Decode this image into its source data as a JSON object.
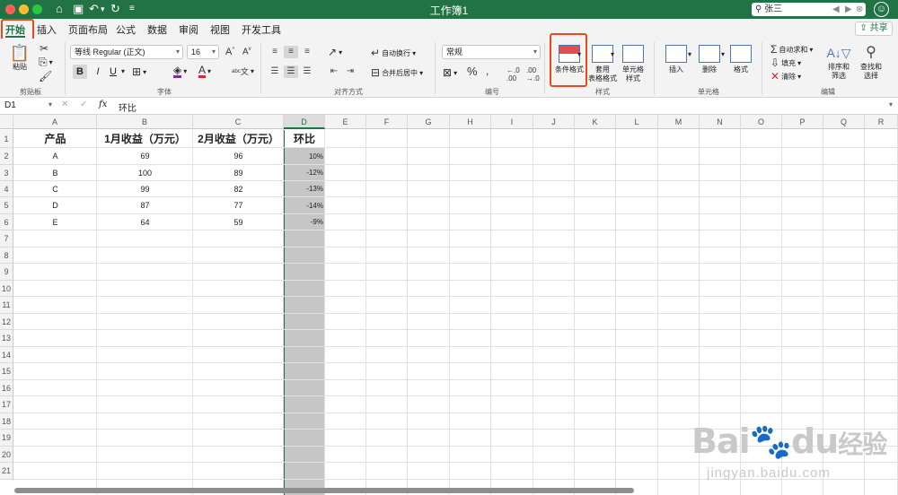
{
  "app": {
    "title": "工作簿1",
    "search_value": "张三",
    "share_label": "共享"
  },
  "menu": {
    "tabs": [
      "开始",
      "插入",
      "页面布局",
      "公式",
      "数据",
      "审阅",
      "视图",
      "开发工具"
    ]
  },
  "ribbon": {
    "clipboard": {
      "paste": "粘贴",
      "label": "剪贴板"
    },
    "font": {
      "name": "等线 Regular (正文)",
      "size": "16",
      "bold": "B",
      "italic": "I",
      "underline": "U",
      "label": "字体"
    },
    "alignment": {
      "wrap": "自动换行",
      "merge": "合并后居中",
      "label": "对齐方式"
    },
    "number": {
      "format": "常规",
      "percent": "%",
      "label": "编号"
    },
    "styles": {
      "conditional": "条件格式",
      "table_line1": "套用",
      "table_line2": "表格格式",
      "cell_line1": "单元格",
      "cell_line2": "样式",
      "label": "样式"
    },
    "cells": {
      "insert": "插入",
      "delete": "删除",
      "format": "格式",
      "label": "单元格"
    },
    "editing": {
      "autosum": "自动求和",
      "fill": "填充",
      "clear": "清除",
      "sort_line1": "排序和",
      "sort_line2": "筛选",
      "find_line1": "查找和",
      "find_line2": "选择",
      "label": "编辑"
    }
  },
  "formula_bar": {
    "cell_ref": "D1",
    "fx": "fx",
    "content": "环比"
  },
  "columns": [
    "A",
    "B",
    "C",
    "D",
    "E",
    "F",
    "G",
    "H",
    "I",
    "J",
    "K",
    "L",
    "M",
    "N",
    "O",
    "P",
    "Q",
    "R"
  ],
  "rows": [
    "1",
    "2",
    "3",
    "4",
    "5",
    "6",
    "7",
    "8",
    "9",
    "10",
    "11",
    "12",
    "13",
    "14",
    "15",
    "16",
    "17",
    "18",
    "19",
    "20",
    "21"
  ],
  "table": {
    "headers": [
      "产品",
      "1月收益（万元）",
      "2月收益（万元）",
      "环比"
    ],
    "data": [
      [
        "A",
        "69",
        "96",
        "10%"
      ],
      [
        "B",
        "100",
        "89",
        "-12%"
      ],
      [
        "C",
        "99",
        "82",
        "-13%"
      ],
      [
        "D",
        "87",
        "77",
        "-14%"
      ],
      [
        "E",
        "64",
        "59",
        "-9%"
      ]
    ]
  },
  "watermark": {
    "brand": "Bai",
    "brand2": "du",
    "brand_cn": "经验",
    "url": "jingyan.baidu.com"
  },
  "colors": {
    "accent": "#217346",
    "highlight": "#e8491d",
    "selection": "#c6c6c6"
  }
}
